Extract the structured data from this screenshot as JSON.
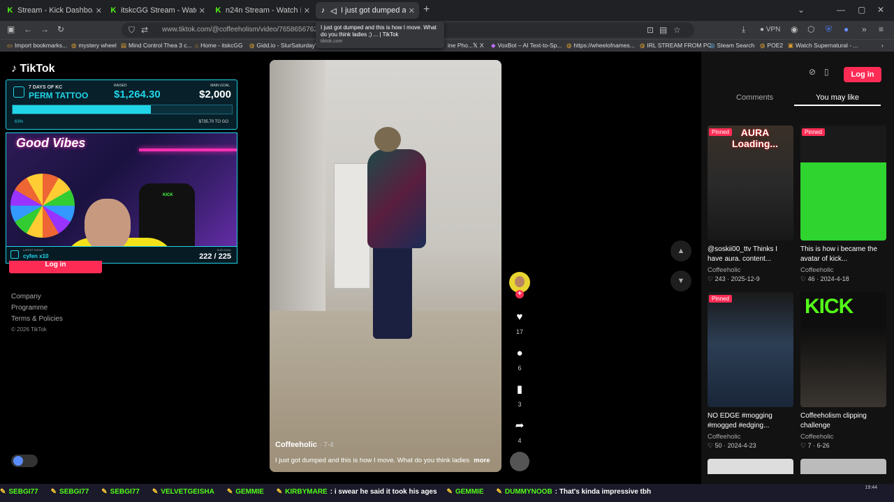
{
  "browser": {
    "tabs": [
      {
        "label": "Stream - Kick Dashboard",
        "icon": "kick-icon"
      },
      {
        "label": "itskcGG Stream - Watch Live on Kick",
        "icon": "kick-icon"
      },
      {
        "label": "n24n Stream - Watch Live on Kick",
        "icon": "kick-icon"
      },
      {
        "label": "I just got dumped and this is how I move",
        "icon": "tiktok-icon",
        "active": true
      }
    ],
    "tooltip": {
      "title": "I just got dumped and this is how I move. What do you think ladies ;) ... | TikTok",
      "domain": "tiktok.com"
    },
    "url": "www.tiktok.com/@coffeeholism/video/76586567622",
    "vpn_label": "VPN",
    "bookmarks": [
      "Import bookmarks...",
      "mystery wheel",
      "Mind Control Thea 3 c...",
      "Home - itskcGG",
      "Gidd.io - SlurSaturday'...",
      "ine Pho...",
      "X",
      "VoxBot – AI Text-to-Sp...",
      "https://wheelofnames...",
      "IRL STREAM FROM PC",
      "Steam Search",
      "POE2",
      "Watch Supernatural - ..."
    ]
  },
  "overlay": {
    "campaign_line1": "7 DAYS OF KC",
    "campaign_line2": "PERM TATTOO",
    "raised_label": "RAISED",
    "raised": "$1,264.30",
    "goal_label": "MAIN GOAL",
    "goal": "$2,000",
    "progress_pct_label": "63%",
    "progress_fraction": 0.63,
    "to_go": "$735.70 TO GO",
    "webcam_sign": "Good Vibes",
    "chair_brand": "KICK",
    "latest_event_label": "LATEST EVENT",
    "latest_event": "cyfen x10",
    "sub_goal_label": "SUB GOAL",
    "sub_goal": "222 / 225"
  },
  "tiktok": {
    "logo": "TikTok",
    "login_left": "Log in",
    "footer": [
      "Company",
      "Programme",
      "Terms & Policies"
    ],
    "copyright": "© 2026 TikTok",
    "video": {
      "author": "Coffeeholic",
      "date": "· 7-4",
      "caption": "I just got dumped and this is how I move. What do you think ladies",
      "more": "more",
      "likes": "17",
      "comments": "6",
      "saves": "3",
      "shares": "4"
    },
    "login_button": "Log in",
    "tabs": {
      "comments": "Comments",
      "you_may_like": "You may like"
    },
    "cards": [
      {
        "pinned": "Pinned",
        "overlay_text": "AURA Loading...",
        "caption": "@soskii00_ttv Thinks I have aura. content...",
        "author": "Coffeeholic",
        "likes": "243",
        "date": "2025-12-9"
      },
      {
        "pinned": "Pinned",
        "overlay_text": "",
        "caption": "This is how i became the avatar of kick...",
        "author": "Coffeeholic",
        "likes": "46",
        "date": "2024-4-18"
      },
      {
        "pinned": "Pinned",
        "overlay_text": "",
        "caption": "NO EDGE #mogging #mogged #edging...",
        "author": "Coffeeholic",
        "likes": "50",
        "date": "2024-4-23"
      },
      {
        "pinned": "",
        "overlay_text": "KICK",
        "caption": "Coffeeholism clipping challenge",
        "author": "Coffeeholic",
        "likes": "7",
        "date": "6-26"
      }
    ]
  },
  "ticker": [
    {
      "name": "SEBGI77",
      "msg": ""
    },
    {
      "name": "SEBGI77",
      "msg": ""
    },
    {
      "name": "SEBGI77",
      "msg": ""
    },
    {
      "name": "VELVETGEISHA",
      "msg": ""
    },
    {
      "name": "GEMMIE",
      "msg": ""
    },
    {
      "name": "KIRBYMARE",
      "msg": "i swear he said it took his ages"
    },
    {
      "name": "GEMMIE",
      "msg": ""
    },
    {
      "name": "DUMMYNOOB",
      "msg": "That's kinda impressive tbh"
    }
  ],
  "clock": {
    "time": "19:44"
  }
}
